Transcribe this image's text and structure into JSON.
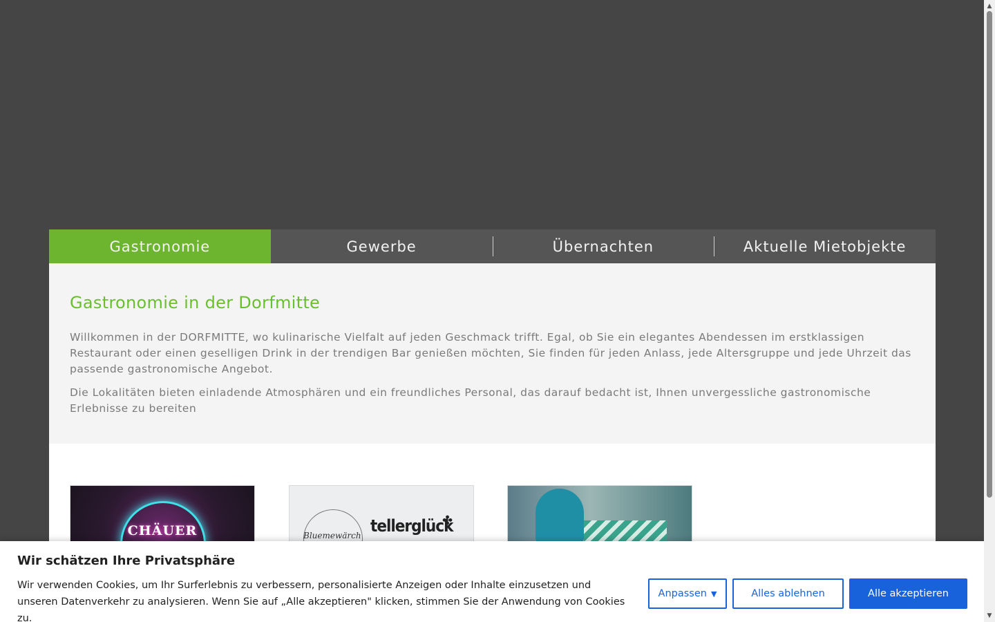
{
  "tabs": [
    {
      "label": "Gastronomie",
      "active": true
    },
    {
      "label": "Gewerbe",
      "active": false
    },
    {
      "label": "Übernachten",
      "active": false
    },
    {
      "label": "Aktuelle Mietobjekte",
      "active": false
    }
  ],
  "content": {
    "title": "Gastronomie in der Dorfmitte",
    "paragraph1": "Willkommen in der DORFMITTE, wo kulinarische Vielfalt auf jeden Geschmack trifft. Egal, ob Sie ein elegantes Abendessen im erstklassigen Restaurant oder einen geselligen Drink in der trendigen Bar genießen möchten, Sie finden für jeden Anlass, jede Altersgruppe und jede Uhrzeit das passende gastronomische Angebot.",
    "paragraph2": "Die Lokalitäten bieten einladende Atmosphären und ein freundliches Personal, das darauf bedacht ist, Ihnen unvergessliche gastronomische Erlebnisse zu bereiten"
  },
  "cards": [
    {
      "logo_text": "CHÄUER"
    },
    {
      "logo_text_1": "Bluemewärch",
      "logo_text_2": "tellerglück"
    },
    {
      "logo_text": ""
    }
  ],
  "cookie": {
    "title": "Wir schätzen Ihre Privatsphäre",
    "text": "Wir verwenden Cookies, um Ihr Surferlebnis zu verbessern, personalisierte Anzeigen oder Inhalte einzusetzen und unseren Datenverkehr zu analysieren. Wenn Sie auf „Alle akzeptieren\" klicken, stimmen Sie der Anwendung von Cookies zu.",
    "customize_label": "Anpassen",
    "reject_label": "Alles ablehnen",
    "accept_label": "Alle akzeptieren"
  },
  "colors": {
    "accent": "#6db52f",
    "hero_bg": "#454545",
    "button_blue": "#1863dc"
  }
}
